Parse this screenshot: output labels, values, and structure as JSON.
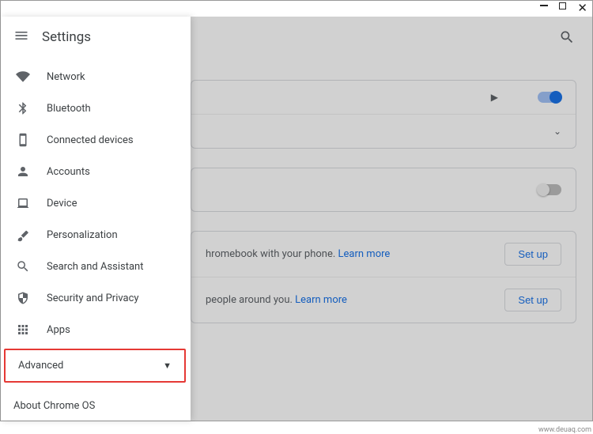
{
  "window": {
    "title": "Settings"
  },
  "sidebar": {
    "title": "Settings",
    "items": [
      {
        "label": "Network"
      },
      {
        "label": "Bluetooth"
      },
      {
        "label": "Connected devices"
      },
      {
        "label": "Accounts"
      },
      {
        "label": "Device"
      },
      {
        "label": "Personalization"
      },
      {
        "label": "Search and Assistant"
      },
      {
        "label": "Security and Privacy"
      },
      {
        "label": "Apps"
      }
    ],
    "advanced": "Advanced",
    "about": "About Chrome OS"
  },
  "main": {
    "card1_row1": {
      "toggle": "on"
    },
    "card3": {
      "row1_text_suffix": "hromebook with your phone. ",
      "row2_text_suffix": " people around you. ",
      "learn_more": "Learn more",
      "setup": "Set up"
    }
  },
  "watermark": "www.deuaq.com"
}
